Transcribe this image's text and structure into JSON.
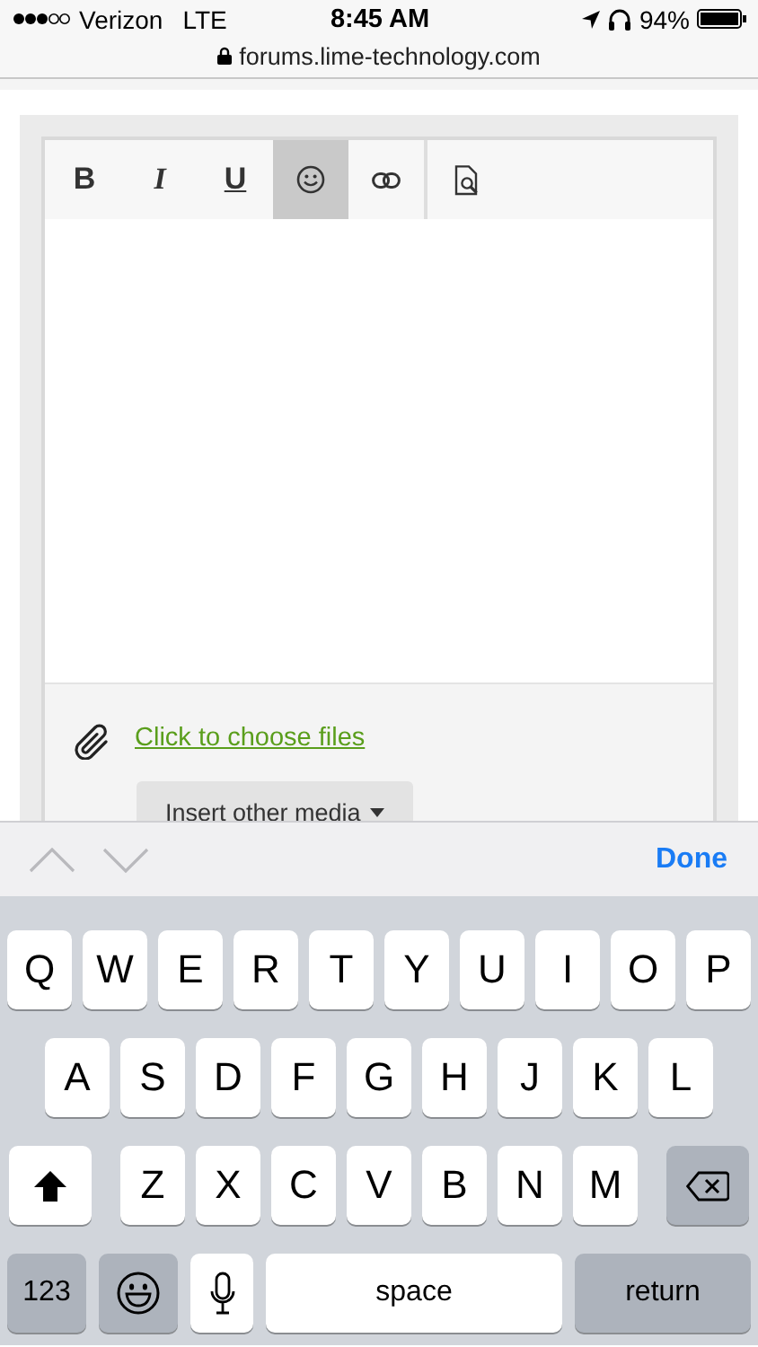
{
  "status_bar": {
    "carrier": "Verizon",
    "network": "LTE",
    "time": "8:45 AM",
    "battery": "94%"
  },
  "address_bar": {
    "url": "forums.lime-technology.com"
  },
  "editor": {
    "tool_groups": [
      [
        {
          "kind": "bold",
          "label": "B",
          "selected": false
        },
        {
          "kind": "italic",
          "label": "I",
          "selected": false
        },
        {
          "kind": "underline",
          "label": "U",
          "selected": false
        },
        {
          "kind": "emoji",
          "selected": true
        },
        {
          "kind": "link",
          "selected": false
        }
      ],
      [
        {
          "kind": "preview",
          "selected": false
        }
      ]
    ],
    "attach_link": "Click to choose files",
    "media_button": "Insert other media"
  },
  "keyboard_bar": {
    "done": "Done"
  },
  "keyboard": {
    "rows": [
      [
        {
          "kind": "letter",
          "label": "Q"
        },
        {
          "kind": "letter",
          "label": "W"
        },
        {
          "kind": "letter",
          "label": "E"
        },
        {
          "kind": "letter",
          "label": "R"
        },
        {
          "kind": "letter",
          "label": "T"
        },
        {
          "kind": "letter",
          "label": "Y"
        },
        {
          "kind": "letter",
          "label": "U"
        },
        {
          "kind": "letter",
          "label": "I"
        },
        {
          "kind": "letter",
          "label": "O"
        },
        {
          "kind": "letter",
          "label": "P"
        }
      ],
      [
        {
          "kind": "letter",
          "label": "A"
        },
        {
          "kind": "letter",
          "label": "S"
        },
        {
          "kind": "letter",
          "label": "D"
        },
        {
          "kind": "letter",
          "label": "F"
        },
        {
          "kind": "letter",
          "label": "G"
        },
        {
          "kind": "letter",
          "label": "H"
        },
        {
          "kind": "letter",
          "label": "J"
        },
        {
          "kind": "letter",
          "label": "K"
        },
        {
          "kind": "letter",
          "label": "L"
        }
      ],
      [
        {
          "kind": "shift"
        },
        {
          "kind": "letter",
          "label": "Z"
        },
        {
          "kind": "letter",
          "label": "X"
        },
        {
          "kind": "letter",
          "label": "C"
        },
        {
          "kind": "letter",
          "label": "V"
        },
        {
          "kind": "letter",
          "label": "B"
        },
        {
          "kind": "letter",
          "label": "N"
        },
        {
          "kind": "letter",
          "label": "M"
        },
        {
          "kind": "delete"
        }
      ]
    ],
    "bottom_keys": [
      {
        "kind": "mode",
        "label": "123"
      },
      {
        "kind": "emoji"
      },
      {
        "kind": "mic"
      },
      {
        "kind": "space",
        "label": "space"
      },
      {
        "kind": "return",
        "label": "return"
      }
    ]
  }
}
